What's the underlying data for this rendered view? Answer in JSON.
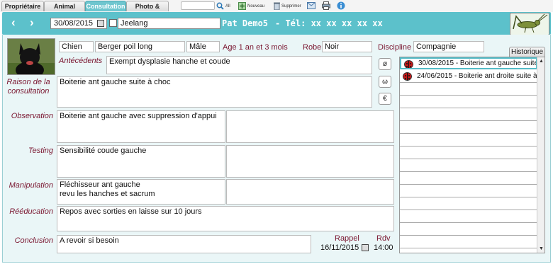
{
  "tabs": [
    "Propriétaire",
    "Animal",
    "Consultation",
    "Photo & Vidéo"
  ],
  "toolbar": {
    "all": "All",
    "new": "Nouveau",
    "delete": "Supprimer"
  },
  "header": {
    "date": "30/08/2015",
    "patient_name": "Jeelang",
    "owner": "Pat Demo5",
    "phone": "-  Tél: xx xx xx xx xx"
  },
  "animal": {
    "species": "Chien",
    "breed": "Berger poil long",
    "sex": "Mâle",
    "age": "Age 1 an et 3 mois",
    "coat_label": "Robe",
    "coat": "Noir",
    "discipline_label": "Discipline",
    "discipline": "Compagnie"
  },
  "labels": {
    "antecedents": "Antécédents",
    "reason": "Raison de la consultation",
    "observation": "Observation",
    "testing": "Testing",
    "manipulation": "Manipulation",
    "reeducation": "Rééducation",
    "conclusion": "Conclusion",
    "rappel": "Rappel",
    "rdv": "Rdv"
  },
  "fields": {
    "antecedents": "Exempt dysplasie hanche et coude",
    "reason": "Boiterie ant gauche suite à choc",
    "observation": "Boiterie ant gauche avec suppression d'appui",
    "observation_right": "",
    "testing": "Sensibilité coude gauche",
    "testing_right": "",
    "manipulation": "Fléchisseur ant gauche\nrevu les hanches et sacrum",
    "manipulation_right": "",
    "reeducation": "Repos avec sorties en laisse sur 10 jours",
    "conclusion": "A revoir si besoin",
    "rappel_date": "16/11/2015",
    "rdv_time": "14:00"
  },
  "side_buttons": [
    "ø",
    "ω",
    "€"
  ],
  "history": {
    "tab_label": "Historique",
    "items": [
      "30/08/2015 - Boiterie ant gauche suite",
      "24/06/2015 - Boiterie ant droite suite à"
    ]
  },
  "colors": {
    "teal": "#5cc1cb",
    "label": "#7a1630",
    "panel": "#eaf6f7"
  }
}
